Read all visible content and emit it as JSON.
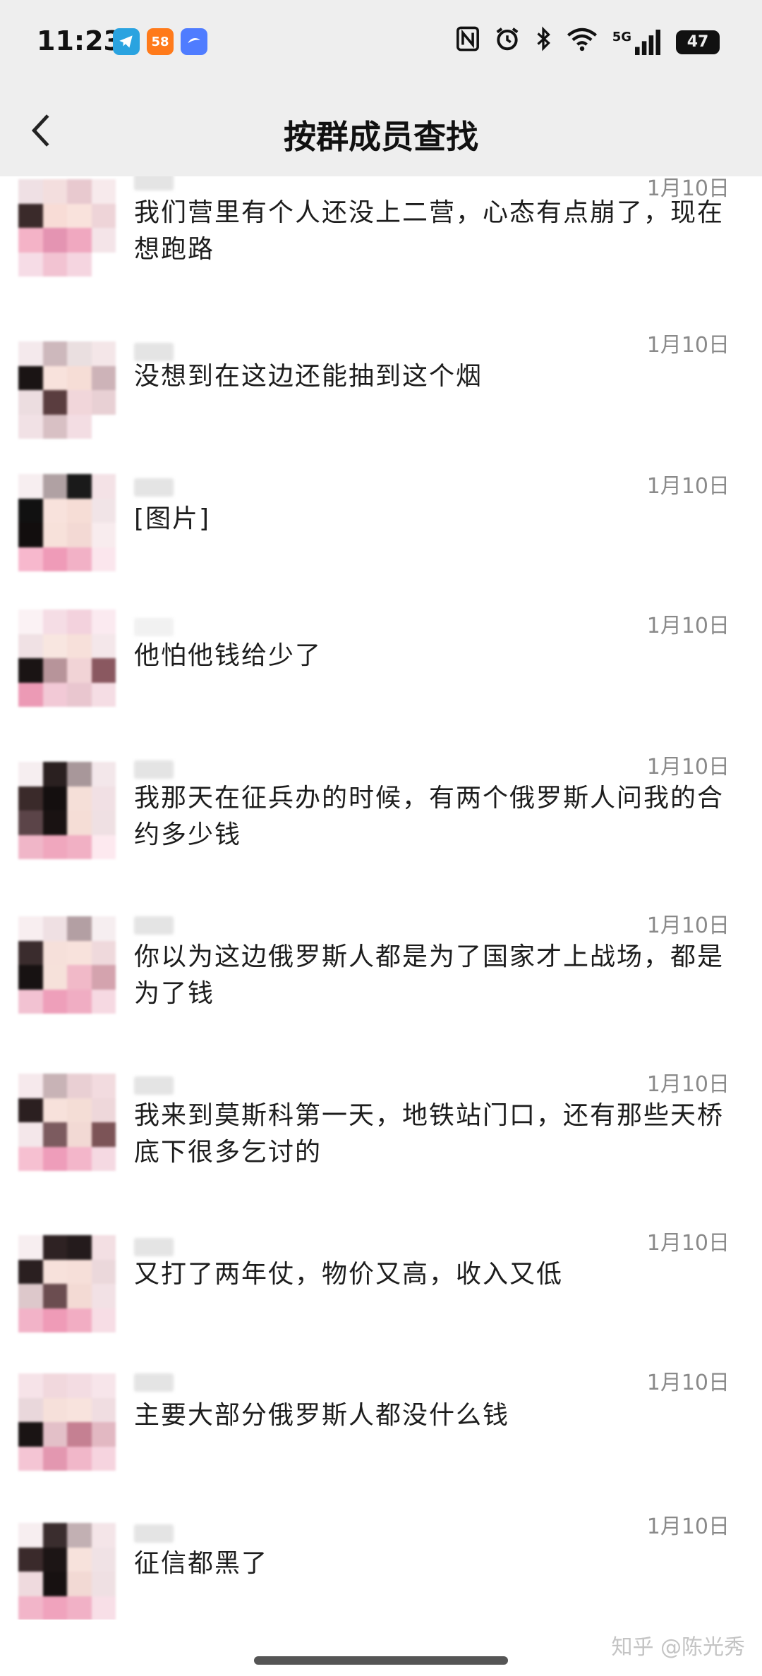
{
  "status_bar": {
    "time": "11:23",
    "notification_icons": [
      {
        "icon": "telegram-icon",
        "label": "",
        "color": "#2aa3e0"
      },
      {
        "icon": "app-58-icon",
        "label": "58",
        "color": "#ff7a1a"
      },
      {
        "icon": "app-blue-icon",
        "label": "",
        "color": "#4f7cff"
      }
    ],
    "system_icons": [
      "nfc-icon",
      "alarm-icon",
      "bluetooth-icon",
      "wifi-icon",
      "5g-signal-icon"
    ],
    "network_label": "5G",
    "battery": "47"
  },
  "nav": {
    "back_icon": "chevron-left-icon",
    "title": "按群成员查找"
  },
  "results": [
    {
      "date": "1月10日",
      "text": "我们营里有个人还没上二营，心态有点崩了，现在想跑路",
      "avatar": [
        "#efe0e4",
        "#f3dede",
        "#e8c9cf",
        "#f7eaec",
        "#3a2a2a",
        "#f8dcd6",
        "#f9e2dc",
        "#eed4d8",
        "#f4b3c7",
        "#e494b2",
        "#f0a8c0",
        "#f4e4e8",
        "#f6dce6",
        "#f2c3d2",
        "#f5d5e0",
        "#ffffff"
      ]
    },
    {
      "date": "1月10日",
      "text": "没想到在这边还能抽到这个烟",
      "avatar": [
        "#f4e9ec",
        "#cdb8bc",
        "#eadfe0",
        "#f4e6e8",
        "#1a1414",
        "#f8e2dc",
        "#f6ddd6",
        "#cdb3b8",
        "#ecdde0",
        "#5a3d3f",
        "#f1d6da",
        "#e8d0d4",
        "#f1e1e5",
        "#d8c0c4",
        "#f3dde3",
        "#ffffff"
      ]
    },
    {
      "date": "1月10日",
      "text": "[图片]",
      "avatar": [
        "#f7eef0",
        "#b0a1a3",
        "#1a1a1a",
        "#f4e2e6",
        "#111111",
        "#f8e2dc",
        "#f6ddd6",
        "#f1e4e7",
        "#120e0e",
        "#f7e1da",
        "#f3d9d4",
        "#f8ecee",
        "#f7b8cd",
        "#ef9bb8",
        "#f2b1c6",
        "#fbe6ed"
      ]
    },
    {
      "date": "1月10日",
      "text": "他怕他钱给少了",
      "avatar": [
        "#fbf2f4",
        "#f5dde5",
        "#f3d2dd",
        "#fbeaf0",
        "#f0e1e4",
        "#f8e6e0",
        "#f7e0da",
        "#f4e7ea",
        "#1a1414",
        "#b7949a",
        "#f1d3d6",
        "#8a5860",
        "#ec9ab5",
        "#f2c9d6",
        "#e9c6cf",
        "#f5dde4"
      ]
    },
    {
      "date": "1月10日",
      "text": "我那天在征兵办的时候，有两个俄罗斯人问我的合约多少钱",
      "avatar": [
        "#f6eef0",
        "#2a2020",
        "#a8979a",
        "#f3e7ea",
        "#3a2a2a",
        "#140f0f",
        "#f5dfd8",
        "#f1e0e4",
        "#5b4448",
        "#191212",
        "#f5ddd6",
        "#efe0e3",
        "#f0b6c8",
        "#f0a7be",
        "#f1b0c4",
        "#fde9ef"
      ]
    },
    {
      "date": "1月10日",
      "text": "你以为这边俄罗斯人都是为了国家才上战场，都是为了钱",
      "avatar": [
        "#f8eef0",
        "#efe0e3",
        "#b39fa3",
        "#f6eef0",
        "#3a2c2d",
        "#f6e0da",
        "#f8e2dc",
        "#efd9dc",
        "#171212",
        "#f6e1da",
        "#f1b9c8",
        "#d4a3ae",
        "#f2c2d2",
        "#ee9fba",
        "#f0adc3",
        "#f6d9e2"
      ]
    },
    {
      "date": "1月10日",
      "text": "我来到莫斯科第一天，地铁站门口，还有那些天桥底下很多乞讨的",
      "avatar": [
        "#f6e9ec",
        "#c8b3b6",
        "#e9cfd3",
        "#f2dbdf",
        "#2b1f20",
        "#f7e1db",
        "#f4ddd6",
        "#eed7da",
        "#f4e7ea",
        "#7c5b5f",
        "#f2d9d4",
        "#7c5457",
        "#f6c0d1",
        "#ee9dba",
        "#f3b6ca",
        "#f5d9e2"
      ]
    },
    {
      "date": "1月10日",
      "text": "又打了两年仗，物价又高，收入又低",
      "avatar": [
        "#f7eef0",
        "#2e2223",
        "#241b1c",
        "#f3dfe3",
        "#2a1f20",
        "#f7e1db",
        "#f6dfd9",
        "#ebd8db",
        "#ddc8cb",
        "#6b4d50",
        "#f3dad4",
        "#f2e1e5",
        "#f2b3c8",
        "#ef9bb7",
        "#f2adc3",
        "#f7dde5"
      ]
    },
    {
      "date": "1月10日",
      "text": "主要大部分俄罗斯人都没什么钱",
      "avatar": [
        "#f6e3e8",
        "#f1d8dd",
        "#f3dce2",
        "#f7e5ea",
        "#e9d7db",
        "#f6e0da",
        "#f8e3dd",
        "#f0dde1",
        "#1a1414",
        "#e3c0c8",
        "#c58092",
        "#e2b8c2",
        "#f4c5d4",
        "#e397b0",
        "#f1b7c9",
        "#f6d4df"
      ]
    },
    {
      "date": "1月10日",
      "text": "征信都黑了",
      "avatar": [
        "#f7eef0",
        "#3a2d2e",
        "#c2b0b3",
        "#f4e5e8",
        "#3a2a2b",
        "#1c1515",
        "#f7e2dc",
        "#f0e2e5",
        "#efdade",
        "#171111",
        "#f2d9d4",
        "#efe0e3",
        "#f2b5c9",
        "#f0a3bd",
        "#f1b1c6",
        "#f8dfe7"
      ]
    }
  ],
  "watermark": "知乎 @陈光秀"
}
